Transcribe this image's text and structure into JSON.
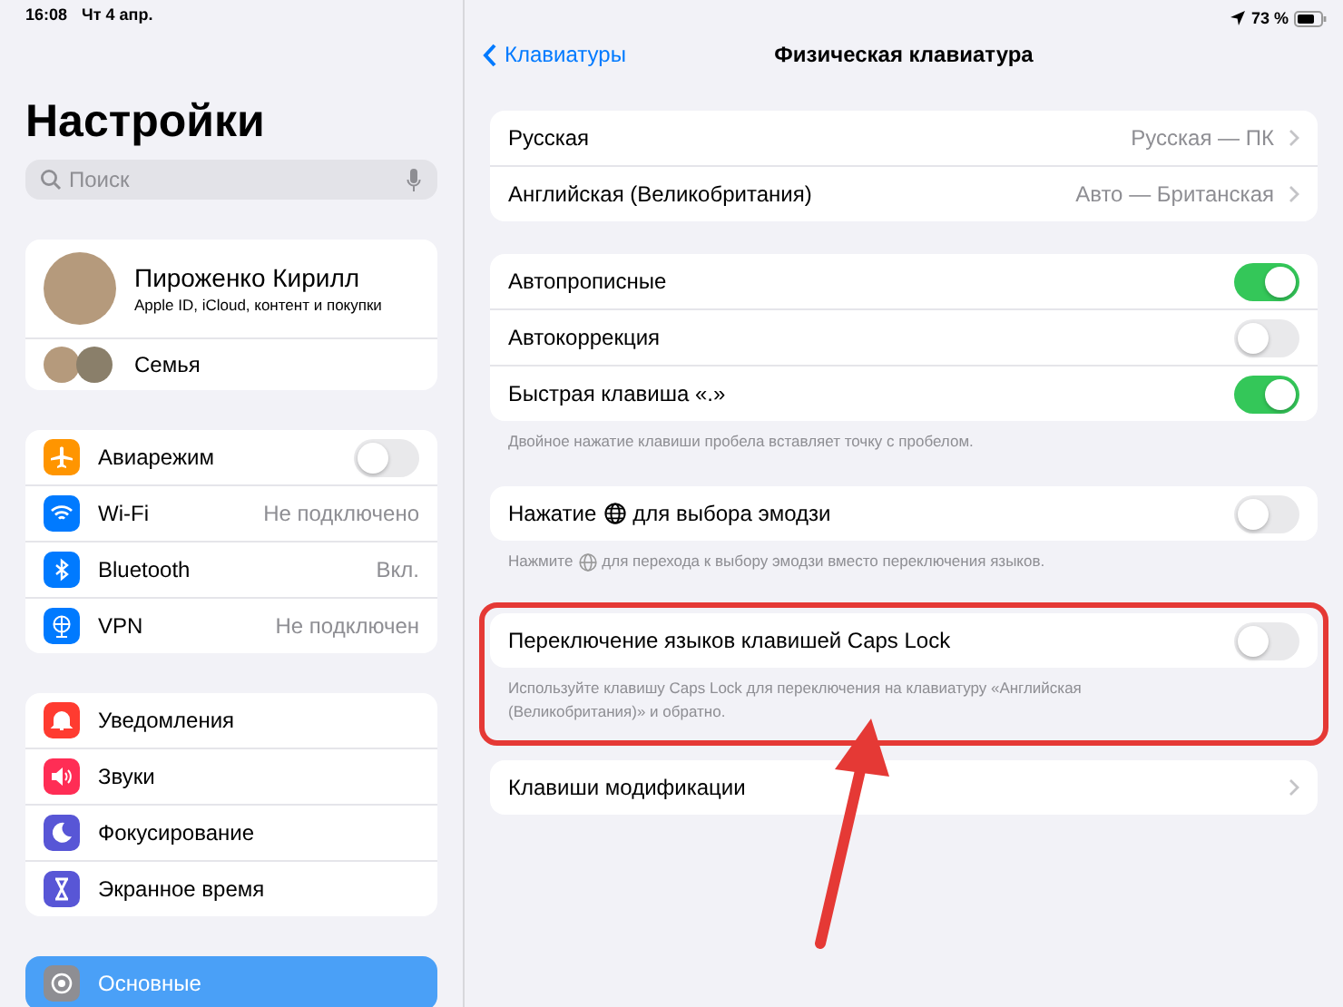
{
  "status_bar": {
    "time": "16:08",
    "date": "Чт 4 апр.",
    "battery": "73 %"
  },
  "sidebar": {
    "title": "Настройки",
    "search": {
      "placeholder": "Поиск"
    },
    "profile": {
      "name": "Пироженко Кирилл",
      "subtitle": "Apple ID, iCloud, контент и покупки",
      "family": "Семья"
    },
    "groups": [
      [
        {
          "label": "Авиарежим",
          "kind": "toggle",
          "on": false,
          "color": "#ff9500",
          "selected": false
        },
        {
          "label": "Wi-Fi",
          "kind": "value",
          "value": "Не подключено",
          "color": "#007aff",
          "selected": false
        },
        {
          "label": "Bluetooth",
          "kind": "value",
          "value": "Вкл.",
          "color": "#007aff",
          "selected": false
        },
        {
          "label": "VPN",
          "kind": "value",
          "value": "Не подключен",
          "color": "#007aff",
          "selected": false
        }
      ],
      [
        {
          "label": "Уведомления",
          "kind": "plain",
          "color": "#ff3b30",
          "selected": false
        },
        {
          "label": "Звуки",
          "kind": "plain",
          "color": "#ff2d55",
          "selected": false
        },
        {
          "label": "Фокусирование",
          "kind": "plain",
          "color": "#5856d6",
          "selected": false
        },
        {
          "label": "Экранное время",
          "kind": "plain",
          "color": "#5856d6",
          "selected": false
        }
      ],
      [
        {
          "label": "Основные",
          "kind": "plain",
          "color": "#8e8e93",
          "selected": true
        }
      ]
    ]
  },
  "detail": {
    "back": "Клавиатуры",
    "title": "Физическая клавиатура",
    "sections": [
      {
        "rows": [
          {
            "kind": "nav",
            "label": "Русская",
            "value": "Русская — ПК"
          },
          {
            "kind": "nav",
            "label": "Английская (Великобритания)",
            "value": "Авто — Британская"
          }
        ]
      },
      {
        "rows": [
          {
            "kind": "toggle",
            "label": "Автопрописные",
            "on": true
          },
          {
            "kind": "toggle",
            "label": "Автокоррекция",
            "on": false
          },
          {
            "kind": "toggle",
            "label": "Быстрая клавиша «.»",
            "on": true
          }
        ],
        "footer": "Двойное нажатие клавиши пробела вставляет точку с пробелом."
      },
      {
        "rows": [
          {
            "kind": "globe-toggle",
            "label": "Нажатие",
            "label_after": "для выбора эмодзи",
            "on": false
          }
        ],
        "footer": "Нажмите",
        "footer_after": "для перехода к выбору эмодзи вместо переключения языков."
      },
      {
        "highlighted": true,
        "rows": [
          {
            "kind": "toggle",
            "label": "Переключение языков клавишей Caps Lock",
            "on": false
          }
        ],
        "footer": "Используйте клавишу Caps Lock для переключения на клавиатуру «Английская (Великобритания)» и обратно."
      },
      {
        "rows": [
          {
            "kind": "nav",
            "label": "Клавиши модификации"
          }
        ]
      }
    ]
  }
}
